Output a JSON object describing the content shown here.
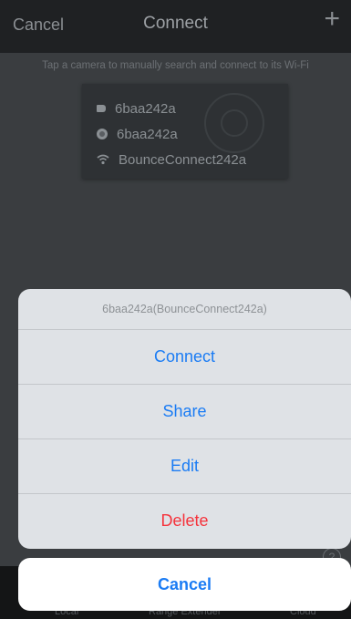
{
  "nav": {
    "cancel_label": "Cancel",
    "title": "Connect",
    "add_symbol": "+"
  },
  "hint": "Tap a camera to manually search and connect to its Wi-Fi",
  "camera": {
    "name": "6baa242a",
    "device_id": "6baa242a",
    "wifi": "BounceConnect242a",
    "icons": [
      "tag-icon",
      "camera-dot-icon",
      "wifi-icon"
    ]
  },
  "tabs": [
    "Local",
    "Range Extender",
    "Cloud"
  ],
  "help_symbol": "?",
  "action_sheet": {
    "title": "6baa242a(BounceConnect242a)",
    "actions": [
      "Connect",
      "Share",
      "Edit",
      "Delete"
    ],
    "cancel_label": "Cancel"
  },
  "colors": {
    "accent": "#1b7cf4",
    "destructive": "#f5333c",
    "sheet_bg": "#dfe2e6"
  }
}
